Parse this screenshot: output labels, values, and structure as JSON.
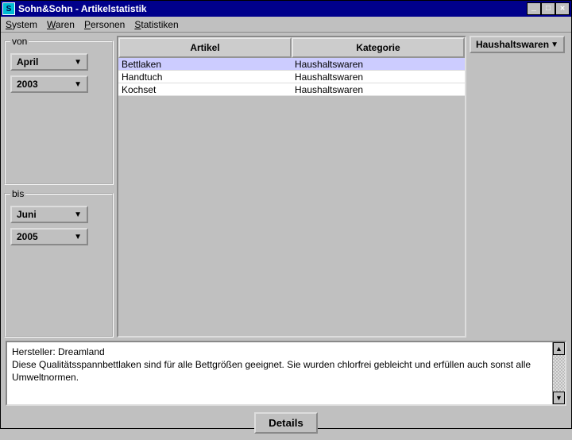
{
  "window": {
    "title": "Sohn&Sohn - Artikelstatistik"
  },
  "menubar": {
    "system": "System",
    "waren": "Waren",
    "personen": "Personen",
    "statistiken": "Statistiken"
  },
  "von": {
    "legend": "von",
    "month": "April",
    "year": "2003"
  },
  "bis": {
    "legend": "bis",
    "month": "Juni",
    "year": "2005"
  },
  "table": {
    "header_artikel": "Artikel",
    "header_kategorie": "Kategorie",
    "rows": [
      {
        "artikel": "Bettlaken",
        "kategorie": "Haushaltswaren"
      },
      {
        "artikel": "Handtuch",
        "kategorie": "Haushaltswaren"
      },
      {
        "artikel": "Kochset",
        "kategorie": "Haushaltswaren"
      }
    ]
  },
  "filter": {
    "category": "Haushaltswaren"
  },
  "details": {
    "line1": "Hersteller: Dreamland",
    "line2": "",
    "line3": "Diese Qualitätsspannbettlaken sind für alle Bettgrößen geeignet. Sie wurden chlorfrei gebleicht und erfüllen auch sonst alle Umweltnormen."
  },
  "buttons": {
    "details": "Details"
  }
}
